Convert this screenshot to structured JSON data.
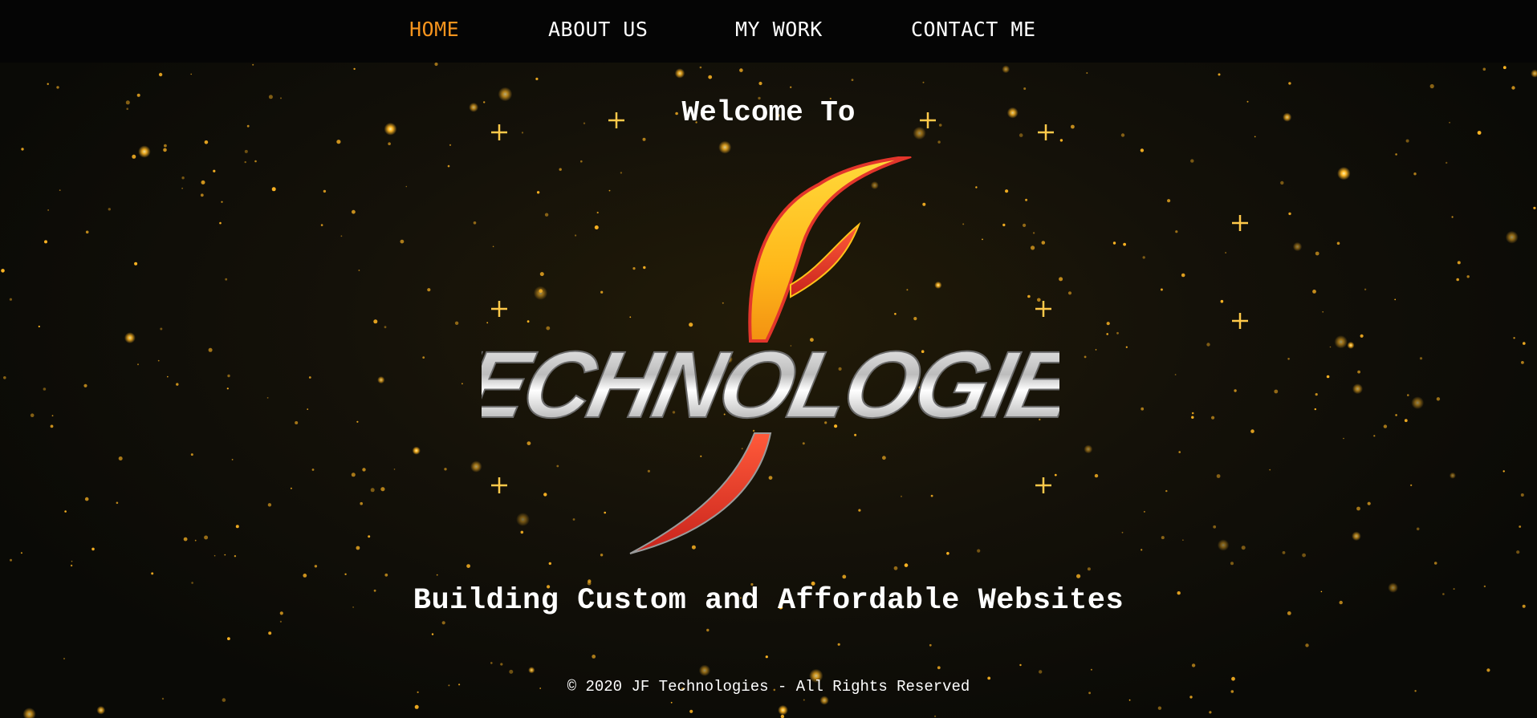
{
  "nav": {
    "items": [
      {
        "label": "HOME",
        "active": true
      },
      {
        "label": "ABOUT US",
        "active": false
      },
      {
        "label": "MY WORK",
        "active": false
      },
      {
        "label": "CONTACT ME",
        "active": false
      }
    ]
  },
  "hero": {
    "welcome": "Welcome To",
    "logo_word": "TECHNOLOGIES",
    "tagline": "Building Custom and Affordable Websites"
  },
  "footer": {
    "copyright": "© 2020 JF Technologies - All Rights Reserved"
  },
  "colors": {
    "accent": "#f7941d",
    "nav_bg": "#050505",
    "text": "#ffffff",
    "glow": "#ffb623",
    "logo_red": "#e2352b",
    "logo_yellow": "#ffc21a"
  }
}
